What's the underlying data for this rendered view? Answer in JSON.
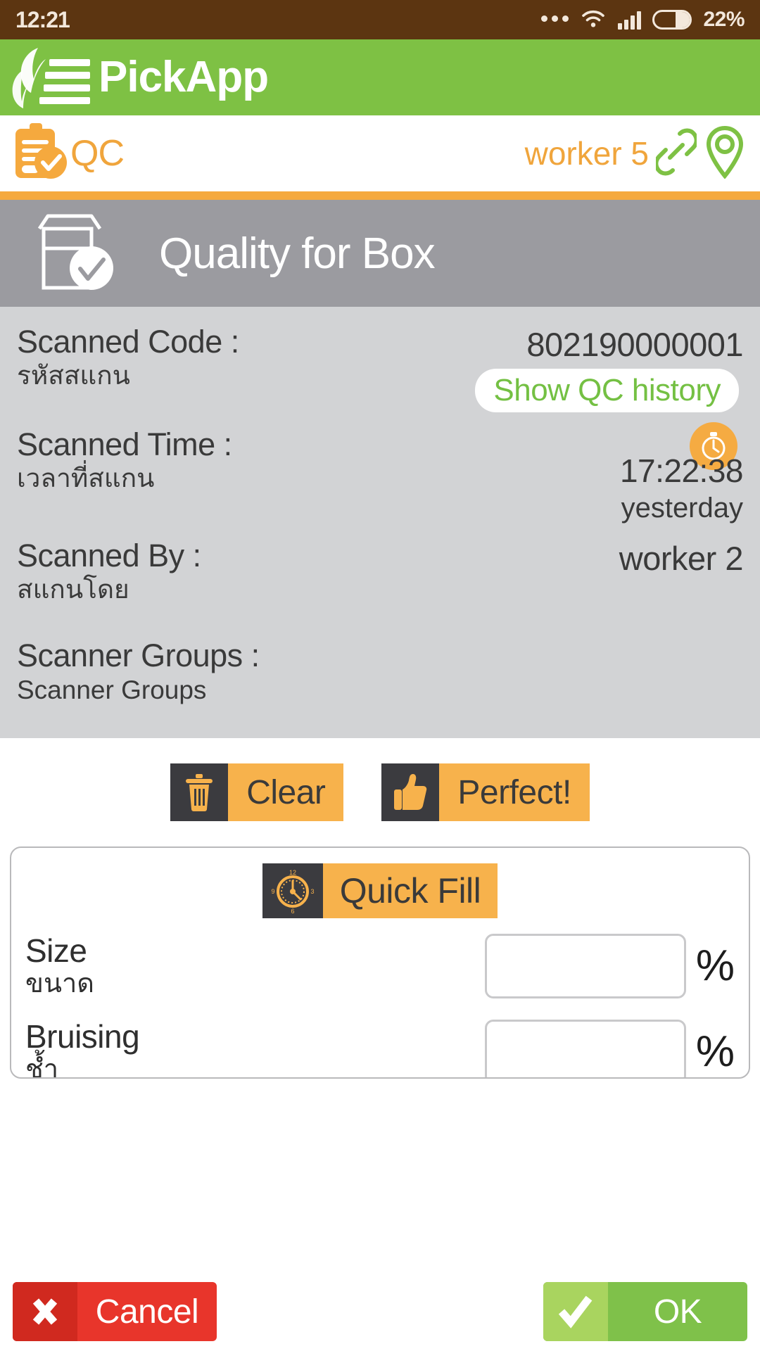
{
  "status_bar": {
    "time": "12:21",
    "battery_percent": "22%",
    "icons": [
      "more-dots-icon",
      "wifi-icon",
      "signal-icon",
      "battery-icon"
    ],
    "background_color": "#5c3511"
  },
  "brand": {
    "name": "PickApp",
    "logo_icon": "pickapp-leaf-logo",
    "background_color": "#7ec144"
  },
  "context_bar": {
    "module_icon": "clipboard-check-icon",
    "module_label": "QC",
    "worker": "worker 5",
    "link_icon": "chain-link-icon",
    "location_icon": "location-pin-icon",
    "accent_color": "#f0a53c"
  },
  "page": {
    "icon": "box-check-icon",
    "title": "Quality for Box",
    "header_color": "#9b9ba0"
  },
  "info": {
    "scanned_code": {
      "label_en": "Scanned Code :",
      "label_th": "รหัสสแกน",
      "value": "802190000001",
      "history_button": "Show QC history"
    },
    "scanned_time": {
      "label_en": "Scanned Time :",
      "label_th": "เวลาที่สแกน",
      "value": "17:22:38",
      "relative": "yesterday",
      "badge_icon": "stopwatch-icon"
    },
    "scanned_by": {
      "label_en": "Scanned By :",
      "label_th": "สแกนโดย",
      "value": "worker 2"
    },
    "scanner_groups": {
      "label_en": "Scanner Groups :",
      "label_th": "Scanner Groups"
    }
  },
  "actions": {
    "clear": {
      "label": "Clear",
      "icon": "trash-icon"
    },
    "perfect": {
      "label": "Perfect!",
      "icon": "thumbs-up-icon"
    }
  },
  "quick_fill": {
    "label": "Quick Fill",
    "icon": "clock-icon",
    "fields": [
      {
        "label_en": "Size",
        "label_th": "ขนาด",
        "value": "",
        "placeholder": "",
        "unit": "%"
      },
      {
        "label_en": "Bruising",
        "label_th": "ช้ำ",
        "value": "",
        "placeholder": "",
        "unit": "%"
      }
    ]
  },
  "bottom_bar": {
    "cancel": {
      "label": "Cancel",
      "icon": "cross-icon",
      "color": "#e8352b"
    },
    "ok": {
      "label": "OK",
      "icon": "check-icon",
      "color": "#7fc14a"
    }
  }
}
